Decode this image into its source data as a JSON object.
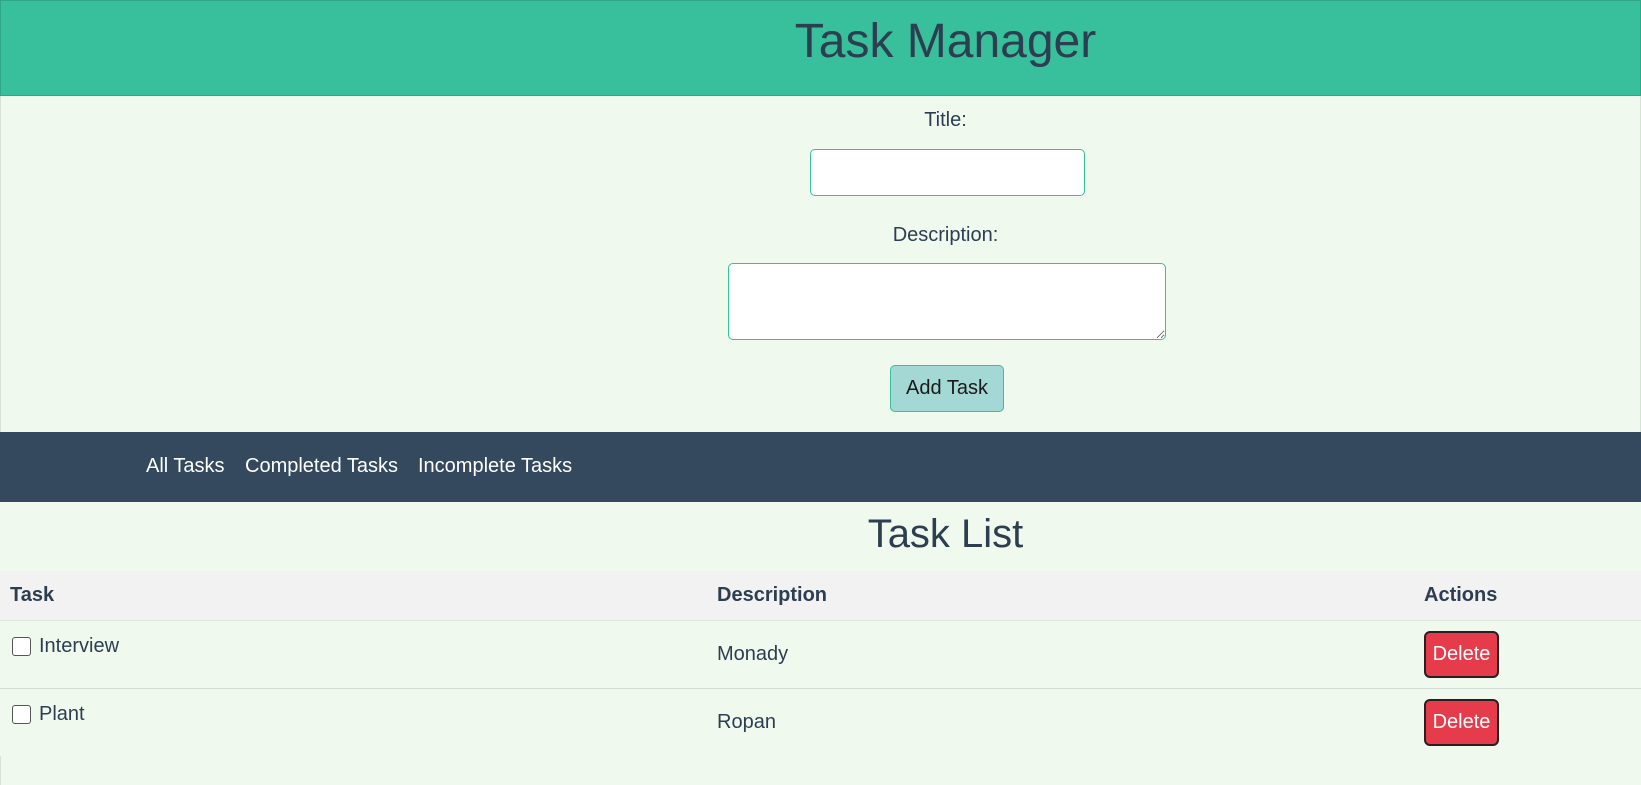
{
  "header": {
    "title": "Task Manager"
  },
  "form": {
    "title_label": "Title:",
    "title_value": "",
    "description_label": "Description:",
    "description_value": "",
    "add_button_label": "Add Task"
  },
  "nav": {
    "items": [
      {
        "label": "All Tasks"
      },
      {
        "label": "Completed Tasks"
      },
      {
        "label": "Incomplete Tasks"
      }
    ]
  },
  "list": {
    "title": "Task List",
    "columns": [
      "Task",
      "Description",
      "Actions"
    ],
    "rows": [
      {
        "task": "Interview",
        "description": "Monady",
        "completed": false,
        "action_label": "Delete"
      },
      {
        "task": "Plant",
        "description": "Ropan",
        "completed": false,
        "action_label": "Delete"
      }
    ]
  },
  "colors": {
    "header_bg": "#38bf9c",
    "page_bg": "#eff9ee",
    "nav_bg": "#34495e",
    "add_button_bg": "#a3d8d5",
    "delete_button_bg": "#e63b4b",
    "text": "#2c3e50"
  }
}
